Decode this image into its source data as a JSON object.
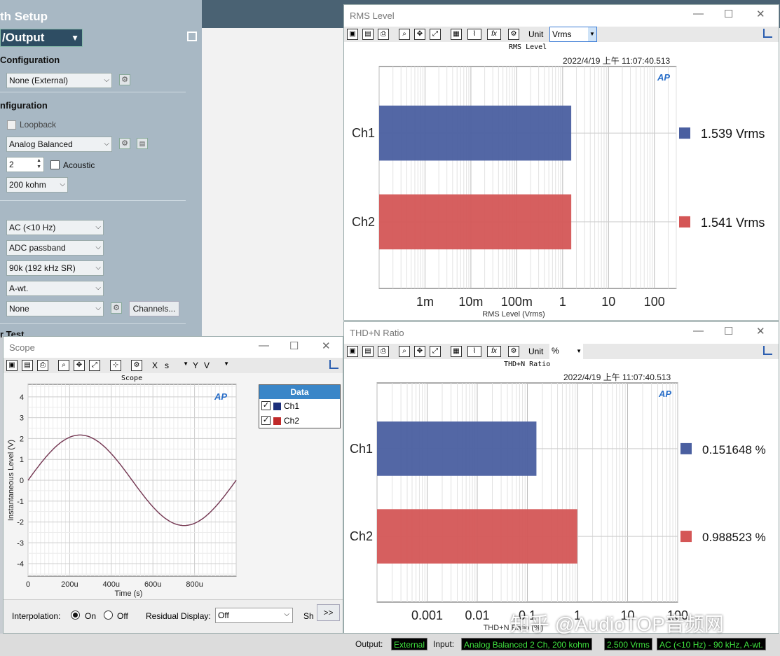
{
  "setup": {
    "title": "th Setup",
    "io_label": "/Output",
    "gen_config_header": "Configuration",
    "gen_select": "None (External)",
    "input_config_header": "nfiguration",
    "loopback_label": "Loopback",
    "connector_select": "Analog Balanced",
    "channels_value": "2",
    "acoustic_label": "Acoustic",
    "impedance_select": "200 kohm",
    "coupling_select": "AC (<10 Hz)",
    "passband_select": "ADC passband",
    "bandwidth_select": "90k (192 kHz SR)",
    "weighting_select": "A-wt.",
    "filter_select": "None",
    "channels_button": "Channels...",
    "test_header": "r Test"
  },
  "rms_window": {
    "title": "RMS Level",
    "unit_label": "Unit",
    "unit_value": "Vrms",
    "plot_title": "RMS Level",
    "timestamp": "2022/4/19 上午 11:07:40.513",
    "logo": "AP"
  },
  "thd_window": {
    "title": "THD+N Ratio",
    "unit_label": "Unit",
    "unit_value": "%",
    "plot_title": "THD+N Ratio",
    "timestamp": "2022/4/19 上午 11:07:40.513",
    "logo": "AP"
  },
  "scope_window": {
    "title": "Scope",
    "x_label": "X",
    "x_unit": "s",
    "y_label": "Y",
    "y_unit": "V",
    "plot_title": "Scope",
    "logo": "AP",
    "data_header": "Data",
    "data_items": [
      "Ch1",
      "Ch2"
    ],
    "interpolation_label": "Interpolation:",
    "on_label": "On",
    "off_label": "Off",
    "residual_label": "Residual Display:",
    "residual_value": "Off",
    "sh_label": "Sh",
    "more_button": ">>"
  },
  "status": {
    "output_label": "Output:",
    "output_value": "External",
    "input_label": "Input:",
    "input_value": "Analog Balanced 2 Ch, 200 kohm",
    "range_value": "2.500 Vrms",
    "filter_value": "AC (<10 Hz) - 90 kHz, A-wt."
  },
  "watermark": "知乎 @AudioTOP音频网",
  "colors": {
    "ch1": "#4a5fa0",
    "ch2": "#d45656",
    "trace": "#7a3a50"
  },
  "chart_data": [
    {
      "type": "bar",
      "orientation": "horizontal",
      "title": "RMS Level",
      "xlabel": "RMS Level (Vrms)",
      "xscale": "log",
      "xlim": [
        0.0001,
        300
      ],
      "xticks": [
        "1m",
        "10m",
        "100m",
        "1",
        "10",
        "100"
      ],
      "categories": [
        "Ch1",
        "Ch2"
      ],
      "values": [
        1.539,
        1.541
      ],
      "value_labels": [
        "1.539  Vrms",
        "1.541  Vrms"
      ],
      "grid": true
    },
    {
      "type": "bar",
      "orientation": "horizontal",
      "title": "THD+N Ratio",
      "xlabel": "THD+N Ratio (%)",
      "xscale": "log",
      "xlim": [
        0.0001,
        100
      ],
      "xticks": [
        "0.001",
        "0.01",
        "0.1",
        "1",
        "10",
        "100"
      ],
      "categories": [
        "Ch1",
        "Ch2"
      ],
      "values": [
        0.151648,
        0.988523
      ],
      "value_labels": [
        "0.151648 %",
        "0.988523 %"
      ],
      "grid": true
    },
    {
      "type": "line",
      "title": "Scope",
      "xlabel": "Time (s)",
      "ylabel": "Instantaneous Level (V)",
      "xlim": [
        0,
        0.001
      ],
      "ylim": [
        -4.6,
        4.6
      ],
      "xticks": [
        "0",
        "200u",
        "400u",
        "600u",
        "800u"
      ],
      "yticks": [
        "4",
        "3",
        "2",
        "1",
        "0",
        "-1",
        "-2",
        "-3",
        "-4"
      ],
      "series": [
        {
          "name": "Ch1",
          "amplitude": 2.17,
          "frequency_hz": 1000
        },
        {
          "name": "Ch2",
          "amplitude": 2.17,
          "frequency_hz": 1000
        }
      ],
      "grid": true
    }
  ]
}
